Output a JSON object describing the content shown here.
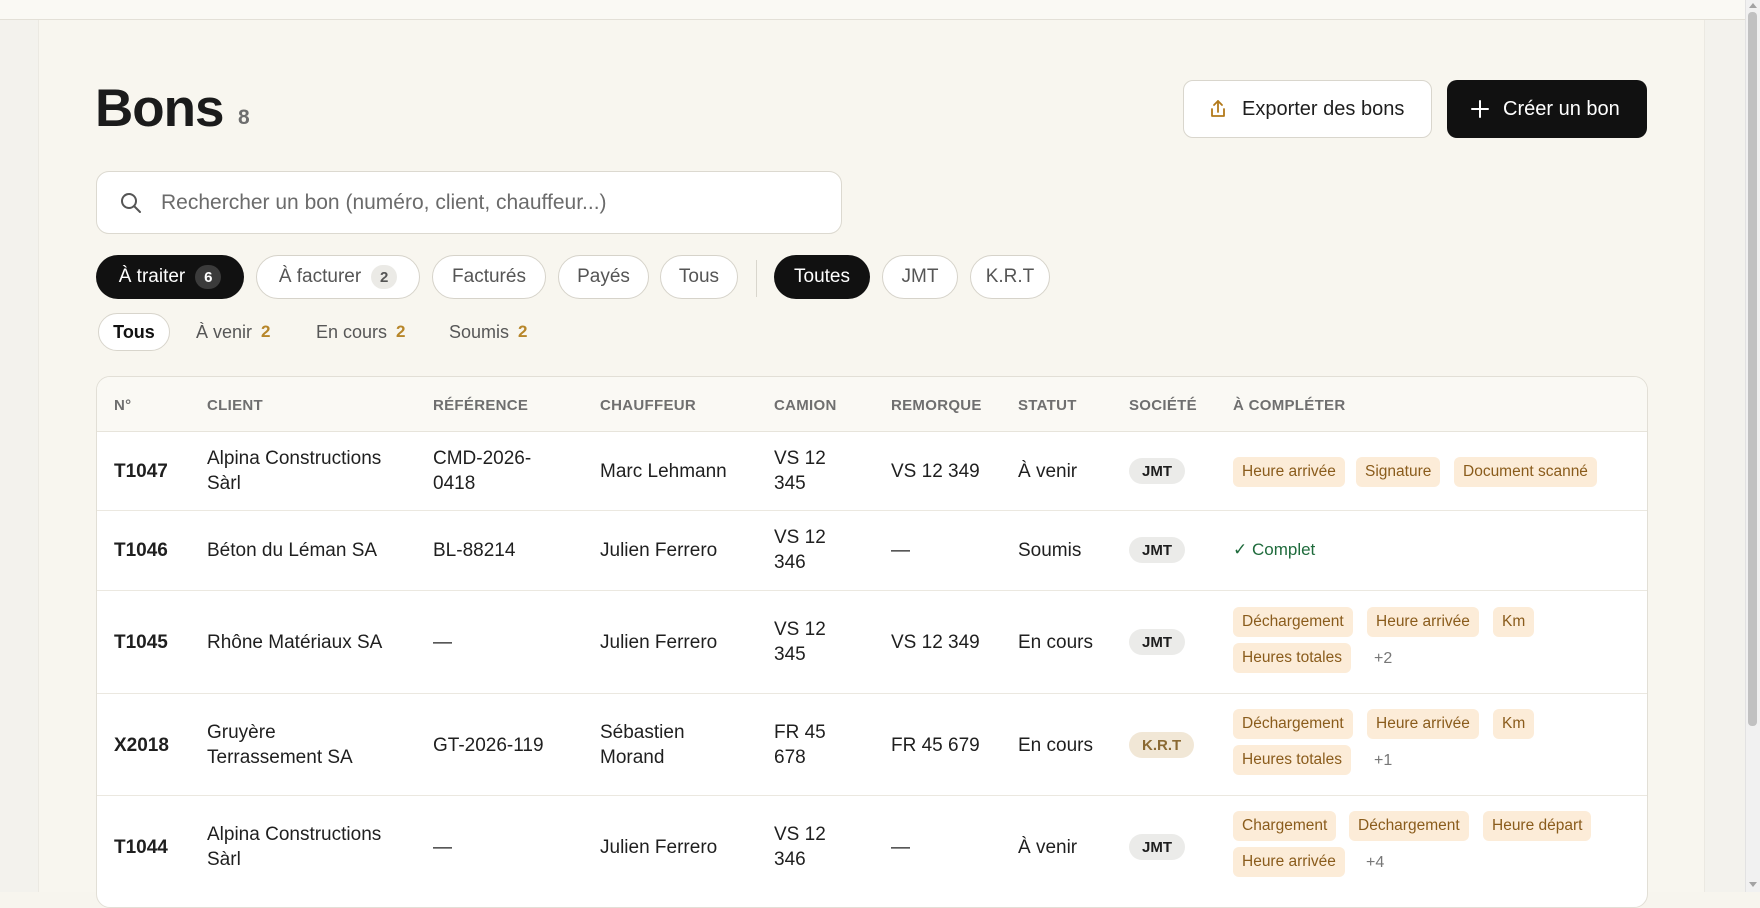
{
  "header": {
    "title": "Bons",
    "count": "8",
    "export_label": "Exporter des bons",
    "create_label": "Créer un bon"
  },
  "search": {
    "placeholder": "Rechercher un bon (numéro, client, chauffeur...)"
  },
  "status_filters": [
    {
      "label": "À traiter",
      "badge": "6",
      "active": true
    },
    {
      "label": "À facturer",
      "badge": "2",
      "active": false
    },
    {
      "label": "Facturés",
      "active": false
    },
    {
      "label": "Payés",
      "active": false
    },
    {
      "label": "Tous",
      "active": false
    }
  ],
  "company_filters": [
    {
      "label": "Toutes",
      "active": true
    },
    {
      "label": "JMT",
      "active": false
    },
    {
      "label": "K.R.T",
      "active": false
    }
  ],
  "sub_tabs": [
    {
      "label": "Tous",
      "active": true
    },
    {
      "label": "À venir",
      "num": "2"
    },
    {
      "label": "En cours",
      "num": "2"
    },
    {
      "label": "Soumis",
      "num": "2"
    }
  ],
  "table": {
    "columns": [
      "N°",
      "CLIENT",
      "RÉFÉRENCE",
      "CHAUFFEUR",
      "CAMION",
      "REMORQUE",
      "STATUT",
      "SOCIÉTÉ",
      "À COMPLÉTER"
    ],
    "rows": [
      {
        "num": "T1047",
        "client": [
          "Alpina Constructions",
          "Sàrl"
        ],
        "reference": [
          "CMD-2026-",
          "0418"
        ],
        "chauffeur": [
          "Marc Lehmann"
        ],
        "camion": [
          "VS 12",
          "345"
        ],
        "remorque": "VS 12 349",
        "statut": "À venir",
        "societe": "JMT",
        "todo": [
          "Heure arrivée",
          "Signature",
          "Document scanné"
        ],
        "more": ""
      },
      {
        "num": "T1046",
        "client": [
          "Béton du Léman SA"
        ],
        "reference": [
          "BL-88214"
        ],
        "chauffeur": [
          "Julien Ferrero"
        ],
        "camion": [
          "VS 12",
          "346"
        ],
        "remorque": "—",
        "statut": "Soumis",
        "societe": "JMT",
        "complete": "✓ Complet"
      },
      {
        "num": "T1045",
        "client": [
          "Rhône Matériaux SA"
        ],
        "reference": [
          "—"
        ],
        "chauffeur": [
          "Julien Ferrero"
        ],
        "camion": [
          "VS 12",
          "345"
        ],
        "remorque": "VS 12 349",
        "statut": "En cours",
        "societe": "JMT",
        "todo": [
          "Déchargement",
          "Heure arrivée",
          "Km",
          "Heures totales"
        ],
        "more": "+2"
      },
      {
        "num": "X2018",
        "client": [
          "Gruyère",
          "Terrassement SA"
        ],
        "reference": [
          "GT-2026-119"
        ],
        "chauffeur": [
          "Sébastien",
          "Morand"
        ],
        "camion": [
          "FR 45",
          "678"
        ],
        "remorque": "FR 45 679",
        "statut": "En cours",
        "societe": "K.R.T",
        "todo": [
          "Déchargement",
          "Heure arrivée",
          "Km",
          "Heures totales"
        ],
        "more": "+1"
      },
      {
        "num": "T1044",
        "client": [
          "Alpina Constructions",
          "Sàrl"
        ],
        "reference": [
          "—"
        ],
        "chauffeur": [
          "Julien Ferrero"
        ],
        "camion": [
          "VS 12",
          "346"
        ],
        "remorque": "—",
        "statut": "À venir",
        "societe": "JMT",
        "todo": [
          "Chargement",
          "Déchargement",
          "Heure départ",
          "Heure arrivée"
        ],
        "more": "+4"
      }
    ]
  },
  "icons": {
    "export": "export-icon",
    "create": "plus-icon",
    "search": "search-icon"
  }
}
